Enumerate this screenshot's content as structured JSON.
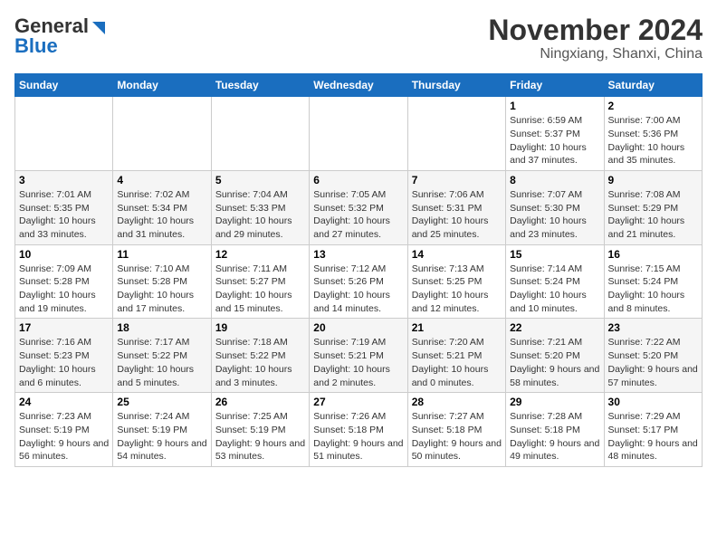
{
  "header": {
    "logo_general": "General",
    "logo_blue": "Blue",
    "title": "November 2024",
    "subtitle": "Ningxiang, Shanxi, China"
  },
  "calendar": {
    "days_of_week": [
      "Sunday",
      "Monday",
      "Tuesday",
      "Wednesday",
      "Thursday",
      "Friday",
      "Saturday"
    ],
    "weeks": [
      [
        {
          "day": "",
          "info": ""
        },
        {
          "day": "",
          "info": ""
        },
        {
          "day": "",
          "info": ""
        },
        {
          "day": "",
          "info": ""
        },
        {
          "day": "",
          "info": ""
        },
        {
          "day": "1",
          "info": "Sunrise: 6:59 AM\nSunset: 5:37 PM\nDaylight: 10 hours and 37 minutes."
        },
        {
          "day": "2",
          "info": "Sunrise: 7:00 AM\nSunset: 5:36 PM\nDaylight: 10 hours and 35 minutes."
        }
      ],
      [
        {
          "day": "3",
          "info": "Sunrise: 7:01 AM\nSunset: 5:35 PM\nDaylight: 10 hours and 33 minutes."
        },
        {
          "day": "4",
          "info": "Sunrise: 7:02 AM\nSunset: 5:34 PM\nDaylight: 10 hours and 31 minutes."
        },
        {
          "day": "5",
          "info": "Sunrise: 7:04 AM\nSunset: 5:33 PM\nDaylight: 10 hours and 29 minutes."
        },
        {
          "day": "6",
          "info": "Sunrise: 7:05 AM\nSunset: 5:32 PM\nDaylight: 10 hours and 27 minutes."
        },
        {
          "day": "7",
          "info": "Sunrise: 7:06 AM\nSunset: 5:31 PM\nDaylight: 10 hours and 25 minutes."
        },
        {
          "day": "8",
          "info": "Sunrise: 7:07 AM\nSunset: 5:30 PM\nDaylight: 10 hours and 23 minutes."
        },
        {
          "day": "9",
          "info": "Sunrise: 7:08 AM\nSunset: 5:29 PM\nDaylight: 10 hours and 21 minutes."
        }
      ],
      [
        {
          "day": "10",
          "info": "Sunrise: 7:09 AM\nSunset: 5:28 PM\nDaylight: 10 hours and 19 minutes."
        },
        {
          "day": "11",
          "info": "Sunrise: 7:10 AM\nSunset: 5:28 PM\nDaylight: 10 hours and 17 minutes."
        },
        {
          "day": "12",
          "info": "Sunrise: 7:11 AM\nSunset: 5:27 PM\nDaylight: 10 hours and 15 minutes."
        },
        {
          "day": "13",
          "info": "Sunrise: 7:12 AM\nSunset: 5:26 PM\nDaylight: 10 hours and 14 minutes."
        },
        {
          "day": "14",
          "info": "Sunrise: 7:13 AM\nSunset: 5:25 PM\nDaylight: 10 hours and 12 minutes."
        },
        {
          "day": "15",
          "info": "Sunrise: 7:14 AM\nSunset: 5:24 PM\nDaylight: 10 hours and 10 minutes."
        },
        {
          "day": "16",
          "info": "Sunrise: 7:15 AM\nSunset: 5:24 PM\nDaylight: 10 hours and 8 minutes."
        }
      ],
      [
        {
          "day": "17",
          "info": "Sunrise: 7:16 AM\nSunset: 5:23 PM\nDaylight: 10 hours and 6 minutes."
        },
        {
          "day": "18",
          "info": "Sunrise: 7:17 AM\nSunset: 5:22 PM\nDaylight: 10 hours and 5 minutes."
        },
        {
          "day": "19",
          "info": "Sunrise: 7:18 AM\nSunset: 5:22 PM\nDaylight: 10 hours and 3 minutes."
        },
        {
          "day": "20",
          "info": "Sunrise: 7:19 AM\nSunset: 5:21 PM\nDaylight: 10 hours and 2 minutes."
        },
        {
          "day": "21",
          "info": "Sunrise: 7:20 AM\nSunset: 5:21 PM\nDaylight: 10 hours and 0 minutes."
        },
        {
          "day": "22",
          "info": "Sunrise: 7:21 AM\nSunset: 5:20 PM\nDaylight: 9 hours and 58 minutes."
        },
        {
          "day": "23",
          "info": "Sunrise: 7:22 AM\nSunset: 5:20 PM\nDaylight: 9 hours and 57 minutes."
        }
      ],
      [
        {
          "day": "24",
          "info": "Sunrise: 7:23 AM\nSunset: 5:19 PM\nDaylight: 9 hours and 56 minutes."
        },
        {
          "day": "25",
          "info": "Sunrise: 7:24 AM\nSunset: 5:19 PM\nDaylight: 9 hours and 54 minutes."
        },
        {
          "day": "26",
          "info": "Sunrise: 7:25 AM\nSunset: 5:19 PM\nDaylight: 9 hours and 53 minutes."
        },
        {
          "day": "27",
          "info": "Sunrise: 7:26 AM\nSunset: 5:18 PM\nDaylight: 9 hours and 51 minutes."
        },
        {
          "day": "28",
          "info": "Sunrise: 7:27 AM\nSunset: 5:18 PM\nDaylight: 9 hours and 50 minutes."
        },
        {
          "day": "29",
          "info": "Sunrise: 7:28 AM\nSunset: 5:18 PM\nDaylight: 9 hours and 49 minutes."
        },
        {
          "day": "30",
          "info": "Sunrise: 7:29 AM\nSunset: 5:17 PM\nDaylight: 9 hours and 48 minutes."
        }
      ]
    ]
  }
}
